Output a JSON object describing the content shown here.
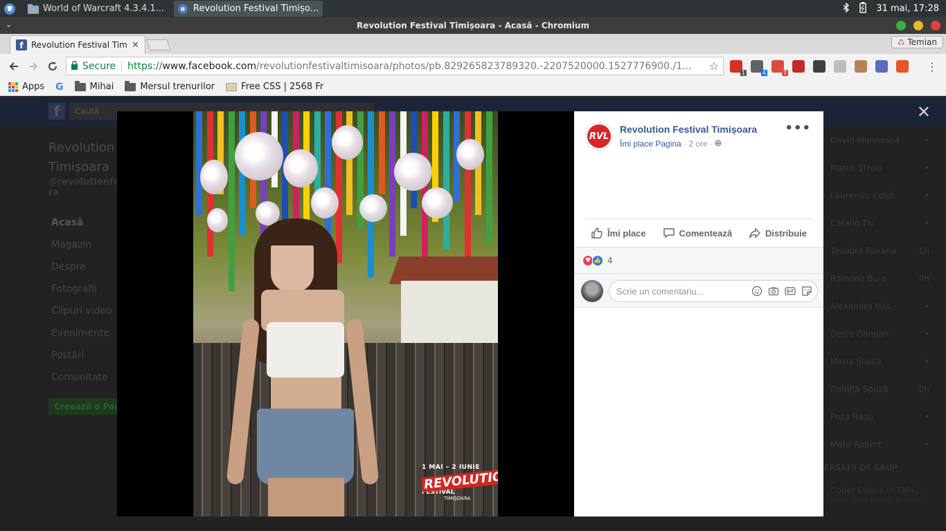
{
  "taskbar": {
    "tasks": [
      {
        "label": "World of Warcraft 4.3.4.1..."
      },
      {
        "label": "Revolution Festival Timișo..."
      }
    ],
    "clock": "31 mai, 17:28"
  },
  "window": {
    "title": "Revolution Festival Timișoara - Acasă - Chromium"
  },
  "tabs": [
    {
      "label": "Revolution Festival Tim"
    }
  ],
  "profile": {
    "label": "Temian"
  },
  "omnibox": {
    "secure_label": "Secure",
    "scheme": "https://",
    "host": "www.facebook.com",
    "path": "/revolutionfestivaltimisoara/photos/pb.829265823789320.-2207520000.1527776900./1..."
  },
  "extensions": [
    {
      "name": "adblock-icon",
      "color": "#d93025",
      "badge": "1",
      "badge_color": "#555"
    },
    {
      "name": "screen-icon",
      "color": "#5f6368",
      "badge": "4",
      "badge_color": "#1a73e8"
    },
    {
      "name": "todo-icon",
      "color": "#db4c3f",
      "badge": "7",
      "badge_color": "#db4c3f"
    },
    {
      "name": "analytics-icon",
      "color": "#c62828",
      "badge": "",
      "badge_color": ""
    },
    {
      "name": "circle-icon",
      "color": "#3c4043",
      "badge": "",
      "badge_color": ""
    },
    {
      "name": "ghost-icon",
      "color": "#bdbdbd",
      "badge": "",
      "badge_color": ""
    },
    {
      "name": "cookie-icon",
      "color": "#b5835a",
      "badge": "",
      "badge_color": ""
    },
    {
      "name": "cloud-icon",
      "color": "#5c6bc0",
      "badge": "",
      "badge_color": ""
    },
    {
      "name": "ubuntu-icon",
      "color": "#e95420",
      "badge": "",
      "badge_color": ""
    }
  ],
  "bookmarks": [
    {
      "label": "Apps"
    },
    {
      "label": ""
    },
    {
      "label": "Mihai"
    },
    {
      "label": "Mersul trenurilor"
    },
    {
      "label": "Free CSS | 2568 Fr"
    }
  ],
  "fb_background": {
    "search_placeholder": "Caută",
    "page_name": "Revolution Timișoara",
    "handle": "@revolutionfes ra",
    "nav": [
      "Acasă",
      "Magazin",
      "Despre",
      "Fotografii",
      "Clipuri video",
      "Evenimente",
      "Postări",
      "Comunitate"
    ],
    "create_page": "Creează o Pagină",
    "chat_contacts": [
      {
        "name": "David Marineasa",
        "status": "•"
      },
      {
        "name": "Marco Strola",
        "status": "•"
      },
      {
        "name": "Laurentiu Cotel",
        "status": "•"
      },
      {
        "name": "Catalin Tiu",
        "status": "•"
      },
      {
        "name": "Teodora Roxana",
        "status": "1h"
      },
      {
        "name": "Ramona Buia",
        "status": "4h"
      },
      {
        "name": "Alexandra Has",
        "status": "•"
      },
      {
        "name": "Denis Damian",
        "status": "•"
      },
      {
        "name": "Maria Stoica",
        "status": "•"
      },
      {
        "name": "Doinița Spuză",
        "status": "2h"
      },
      {
        "name": "Poza Radu",
        "status": "•"
      },
      {
        "name": "Matu Robert",
        "status": "•"
      }
    ],
    "group_header": "ERSAȚII DE GRUP",
    "group": {
      "name": "Coder Dojo x in TM+...",
      "members": "Radu, Vlad-Marko, Bucan..."
    }
  },
  "photo_overlay": {
    "dates": "1 MAI – 2 IUNIE",
    "brand": "REVOLUTION",
    "festival": "FESTIVAL",
    "city": "TIMIȘOARA"
  },
  "post": {
    "page_name": "Revolution Festival Timișoara",
    "avatar_text": "RVL",
    "like_page": "Îmi place Pagina",
    "time": "2 ore",
    "actions": {
      "like": "Îmi place",
      "comment": "Comentează",
      "share": "Distribuie"
    },
    "reaction_count": "4",
    "comment_placeholder": "Scrie un comentariu..."
  }
}
